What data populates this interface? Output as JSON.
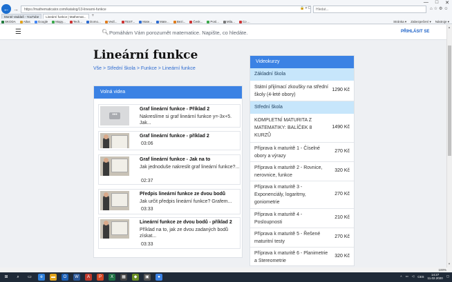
{
  "browser": {
    "url": "https://mathematicator.com/katalog/13-linearni-funkce",
    "search_placeholder": "Hledat...",
    "window_controls": [
      "—",
      "□",
      "✕"
    ],
    "tabs": [
      {
        "label": "Monté Vaddaš - YouTube"
      },
      {
        "label": "Lineární funkce | Mathemat..."
      }
    ],
    "favorites": [
      {
        "label": "SKODA",
        "color": "#1f7a3a"
      },
      {
        "label": "Atlas",
        "color": "#e2a21a"
      },
      {
        "label": "Google",
        "color": "#4285f4"
      },
      {
        "label": "Mapy...",
        "color": "#3aa84a"
      },
      {
        "label": "Tech...",
        "color": "#c33"
      },
      {
        "label": "Domo...",
        "color": "#2d6bd0"
      },
      {
        "label": "Vedí...",
        "color": "#e07b1b"
      },
      {
        "label": "TEST...",
        "color": "#c33"
      },
      {
        "label": "Mate...",
        "color": "#2d6bd0"
      },
      {
        "label": "Mate...",
        "color": "#2d6bd0"
      },
      {
        "label": "Bezi...",
        "color": "#e07b1b"
      },
      {
        "label": "Česk...",
        "color": "#c33"
      },
      {
        "label": "Posl...",
        "color": "#3aa84a"
      },
      {
        "label": "Mila...",
        "color": "#777"
      },
      {
        "label": "Co ...",
        "color": "#c33"
      }
    ],
    "right_menu": [
      "Stránka ▾",
      "Zabezpečení ▾",
      "Nástroje ▾"
    ],
    "zoom": "100%"
  },
  "site": {
    "search_placeholder": "Pomáhám Vám porozumět matematice. Napište, co hledáte.",
    "login_label": "PŘIHLÁSIT SE"
  },
  "page": {
    "title": "Lineární funkce",
    "breadcrumbs": [
      "Vše",
      "Střední škola",
      "Funkce",
      "Lineární funkce"
    ],
    "breadcrumb_sep": " > "
  },
  "free_videos": {
    "header": "Volná videa",
    "items": [
      {
        "title": "Graf lineární funkce - Příklad 2",
        "desc": "Nakreslíme si graf lineární funkce y=-3x+5. Jak...",
        "duration": ""
      },
      {
        "title": "Graf lineární funkce - příklad 2",
        "desc": "",
        "duration": "03:06"
      },
      {
        "title": "Graf lineární funkce - Jak na to",
        "desc": "Jak jednoduše nakreslit graf lineární funkce?...",
        "duration": "02:37"
      },
      {
        "title": "Předpis lineární funkce ze dvou bodů",
        "desc": "Jak určit předpis lineární funkce? Grafem...",
        "duration": "03:33"
      },
      {
        "title": "Lineární funkce ze dvou bodů - příklad 2",
        "desc": "Příklad na to, jak ze dvou zadaných bodů získat...",
        "duration": "03:33"
      }
    ]
  },
  "video_courses": {
    "header": "Videokurzy",
    "sections": [
      {
        "name": "Základní škola",
        "items": [
          {
            "name": "Státní přijímací zkoušky na střední školy (4-leté obory)",
            "price": "1290 Kč"
          }
        ]
      },
      {
        "name": "Střední škola",
        "items": [
          {
            "name": "KOMPLETNÍ MATURITA Z MATEMATIKY: BALÍČEK 8 KURZŮ",
            "price": "1490 Kč"
          },
          {
            "name": "Příprava k maturitě 1 - Číselné obory a výrazy",
            "price": "270 Kč"
          },
          {
            "name": "Příprava k maturitě 2 - Rovnice, nerovnice, funkce",
            "price": "320 Kč"
          },
          {
            "name": "Příprava k maturitě 3 - Exponenciály, logaritmy, goniometrie",
            "price": "270 Kč"
          },
          {
            "name": "Příprava k maturitě 4 - Posloupnosti",
            "price": "210 Kč"
          },
          {
            "name": "Příprava k maturitě 5 - Řešené maturitní testy",
            "price": "270 Kč"
          },
          {
            "name": "Příprava k maturitě 6 - Planimetrie a Stereometrie",
            "price": "320 Kč"
          }
        ]
      }
    ]
  },
  "taskbar": {
    "time": "14:27",
    "date": "11.02.2020",
    "lang": "CES"
  }
}
